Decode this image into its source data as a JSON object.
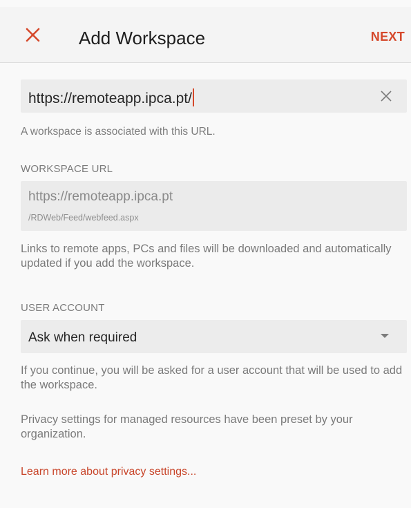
{
  "header": {
    "title": "Add Workspace",
    "next_label": "NEXT",
    "close_icon": "close-icon",
    "accent_color": "#d5482b"
  },
  "url_input": {
    "value": "https://remoteapp.ipca.pt/",
    "clear_icon": "clear-icon",
    "helper": "A workspace is associated with this URL."
  },
  "workspace_url": {
    "label": "WORKSPACE URL",
    "line1": "https://remoteapp.ipca.pt",
    "line2": "/RDWeb/Feed/webfeed.aspx",
    "description": "Links to remote apps, PCs and files will be downloaded and automatically updated if you add the workspace."
  },
  "user_account": {
    "label": "USER ACCOUNT",
    "selected": "Ask when required",
    "description": "If you continue, you will be asked for a user account that will be used to add the workspace."
  },
  "privacy": {
    "notice": "Privacy settings for managed resources have been preset by your organization.",
    "link": "Learn more about privacy settings..."
  }
}
